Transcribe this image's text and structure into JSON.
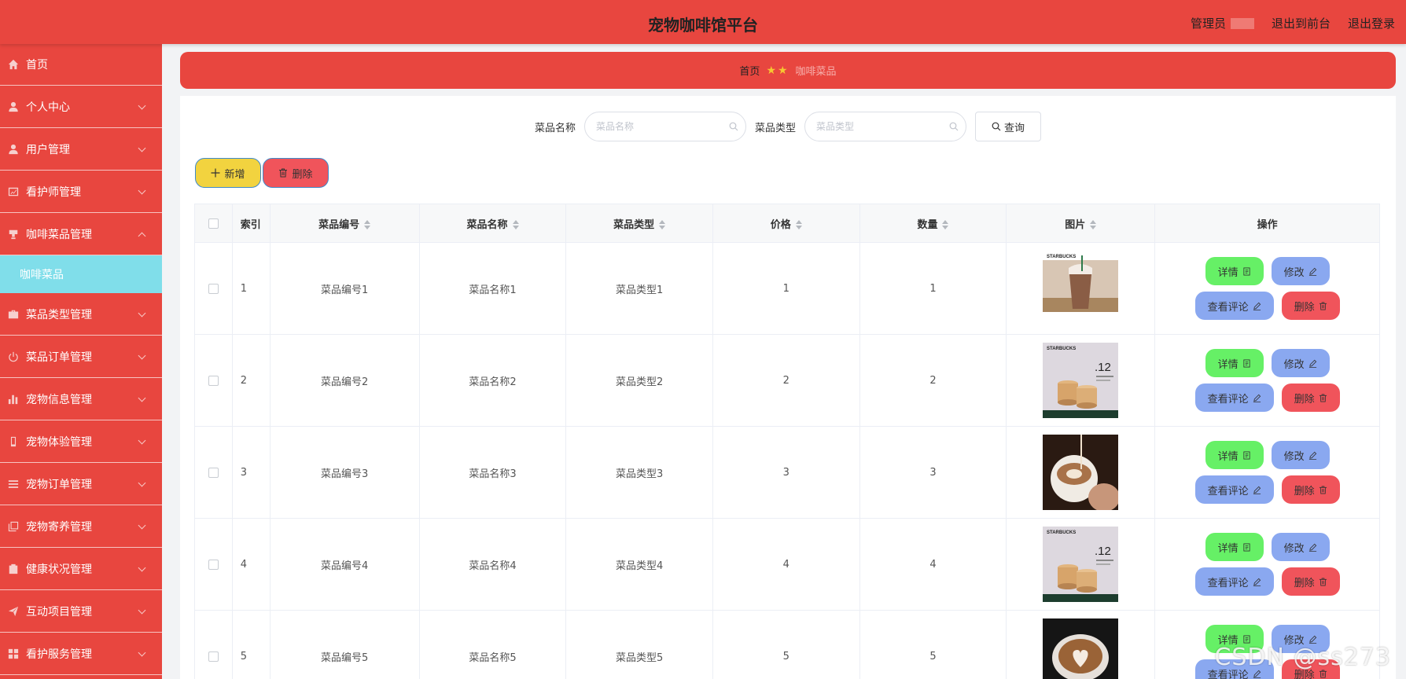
{
  "header": {
    "title": "宠物咖啡馆平台",
    "role": "管理员",
    "to_front": "退出到前台",
    "logout": "退出登录"
  },
  "sidebar": {
    "items": [
      {
        "label": "首页",
        "icon": "home-icon"
      },
      {
        "label": "个人中心",
        "icon": "user-icon"
      },
      {
        "label": "用户管理",
        "icon": "user-icon"
      },
      {
        "label": "看护师管理",
        "icon": "chart-card-icon"
      },
      {
        "label": "咖啡菜品管理",
        "icon": "cup-icon"
      },
      {
        "label": "咖啡菜品",
        "icon": ""
      },
      {
        "label": "菜品类型管理",
        "icon": "briefcase-icon"
      },
      {
        "label": "菜品订单管理",
        "icon": "power-icon"
      },
      {
        "label": "宠物信息管理",
        "icon": "bar-chart-icon"
      },
      {
        "label": "宠物体验管理",
        "icon": "phone-icon"
      },
      {
        "label": "宠物订单管理",
        "icon": "list-icon"
      },
      {
        "label": "宠物寄养管理",
        "icon": "copy-icon"
      },
      {
        "label": "健康状况管理",
        "icon": "clipboard-icon"
      },
      {
        "label": "互动项目管理",
        "icon": "send-icon"
      },
      {
        "label": "看护服务管理",
        "icon": "grid-icon"
      }
    ]
  },
  "breadcrumb": {
    "home": "首页",
    "current": "咖啡菜品"
  },
  "search": {
    "name_label": "菜品名称",
    "name_placeholder": "菜品名称",
    "type_label": "菜品类型",
    "type_placeholder": "菜品类型",
    "query_label": "查询"
  },
  "actions": {
    "add_label": "新增",
    "delete_label": "删除"
  },
  "table": {
    "headers": {
      "index": "索引",
      "code": "菜品编号",
      "name": "菜品名称",
      "type": "菜品类型",
      "price": "价格",
      "qty": "数量",
      "image": "图片",
      "ops": "操作"
    },
    "rows": [
      {
        "index": "1",
        "code": "菜品编号1",
        "name": "菜品名称1",
        "type": "菜品类型1",
        "price": "1",
        "qty": "1",
        "image": "iced-mocha-starbucks",
        "image_text": "STARBUCKS"
      },
      {
        "index": "2",
        "code": "菜品编号2",
        "name": "菜品名称2",
        "type": "菜品类型2",
        "price": "2",
        "qty": "2",
        "image": "starbucks-promo-cups",
        "image_text": "STARBUCKS",
        "image_number": ".12"
      },
      {
        "index": "3",
        "code": "菜品编号3",
        "name": "菜品名称3",
        "type": "菜品类型3",
        "price": "3",
        "qty": "3",
        "image": "latte-art-pour"
      },
      {
        "index": "4",
        "code": "菜品编号4",
        "name": "菜品名称4",
        "type": "菜品类型4",
        "price": "4",
        "qty": "4",
        "image": "starbucks-promo-cups",
        "image_text": "STARBUCKS",
        "image_number": ".12"
      },
      {
        "index": "5",
        "code": "菜品编号5",
        "name": "菜品名称5",
        "type": "菜品类型5",
        "price": "5",
        "qty": "5",
        "image": "latte-heart-dark"
      }
    ],
    "ops": {
      "detail": "详情",
      "edit": "修改",
      "review": "查看评论",
      "delete": "删除"
    }
  },
  "watermark": "CSDN @ss273",
  "colors": {
    "primary_red": "#e8463f",
    "submenu_cyan": "#80deea",
    "detail_green": "#66f066",
    "edit_blue": "#8aa8f0",
    "delete_red": "#f0545b",
    "add_yellow": "#f2d33f"
  }
}
